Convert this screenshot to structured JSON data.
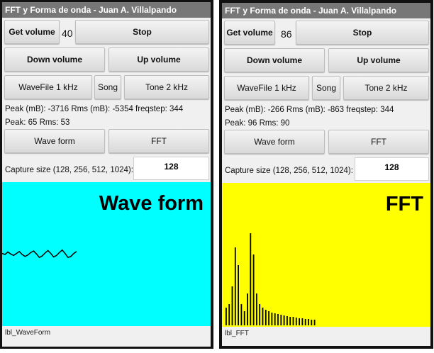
{
  "left": {
    "title": "FFT y Forma de onda - Juan A. Villalpando",
    "get_volume_label": "Get volume",
    "volume_value": "40",
    "stop_label": "Stop",
    "down_volume_label": "Down volume",
    "up_volume_label": "Up volume",
    "wavefile_label": "WaveFile 1 kHz",
    "song_label": "Song",
    "tone_label": "Tone 2  kHz",
    "peak_line1": "Peak (mB): -3716 Rms (mB): -5354 freqstep:  344",
    "peak_line2": "Peak: 65 Rms: 53",
    "waveform_button": "Wave form",
    "fft_button": "FFT",
    "capture_label": "Capture size (128, 256, 512, 1024):",
    "capture_value": "128",
    "canvas_heading": "Wave form",
    "canvas_color": "#00ffff",
    "bottom_label": "lbl_WaveForm"
  },
  "right": {
    "title": "FFT y Forma de onda - Juan A. Villalpando",
    "get_volume_label": "Get volume",
    "volume_value": "86",
    "stop_label": "Stop",
    "down_volume_label": "Down volume",
    "up_volume_label": "Up volume",
    "wavefile_label": "WaveFile 1 kHz",
    "song_label": "Song",
    "tone_label": "Tone 2  kHz",
    "peak_line1": "Peak (mB): -266 Rms (mB): -863 freqstep:  344",
    "peak_line2": "Peak: 96 Rms: 90",
    "waveform_button": "Wave form",
    "fft_button": "FFT",
    "capture_label": "Capture size (128, 256, 512, 1024):",
    "capture_value": "128",
    "canvas_heading": "FFT",
    "canvas_color": "#ffff00",
    "bottom_label": "lbl_FFT"
  },
  "waveform_samples": [
    0.1,
    0.0,
    0.25,
    0.05,
    -0.1,
    0.1,
    0.3,
    0.0,
    -0.2,
    -0.05,
    0.2,
    0.35,
    0.05,
    -0.3,
    -0.15,
    0.15,
    0.4,
    0.1,
    -0.25,
    -0.1,
    0.2,
    0.45,
    0.1,
    -0.3,
    -0.2,
    0.1,
    0.3
  ],
  "fft_bars": [
    25,
    30,
    55,
    110,
    85,
    30,
    20,
    45,
    130,
    100,
    45,
    30,
    25,
    22,
    20,
    18,
    17,
    16,
    15,
    14,
    13,
    12,
    12,
    11,
    10,
    10,
    9,
    9,
    8,
    8
  ]
}
